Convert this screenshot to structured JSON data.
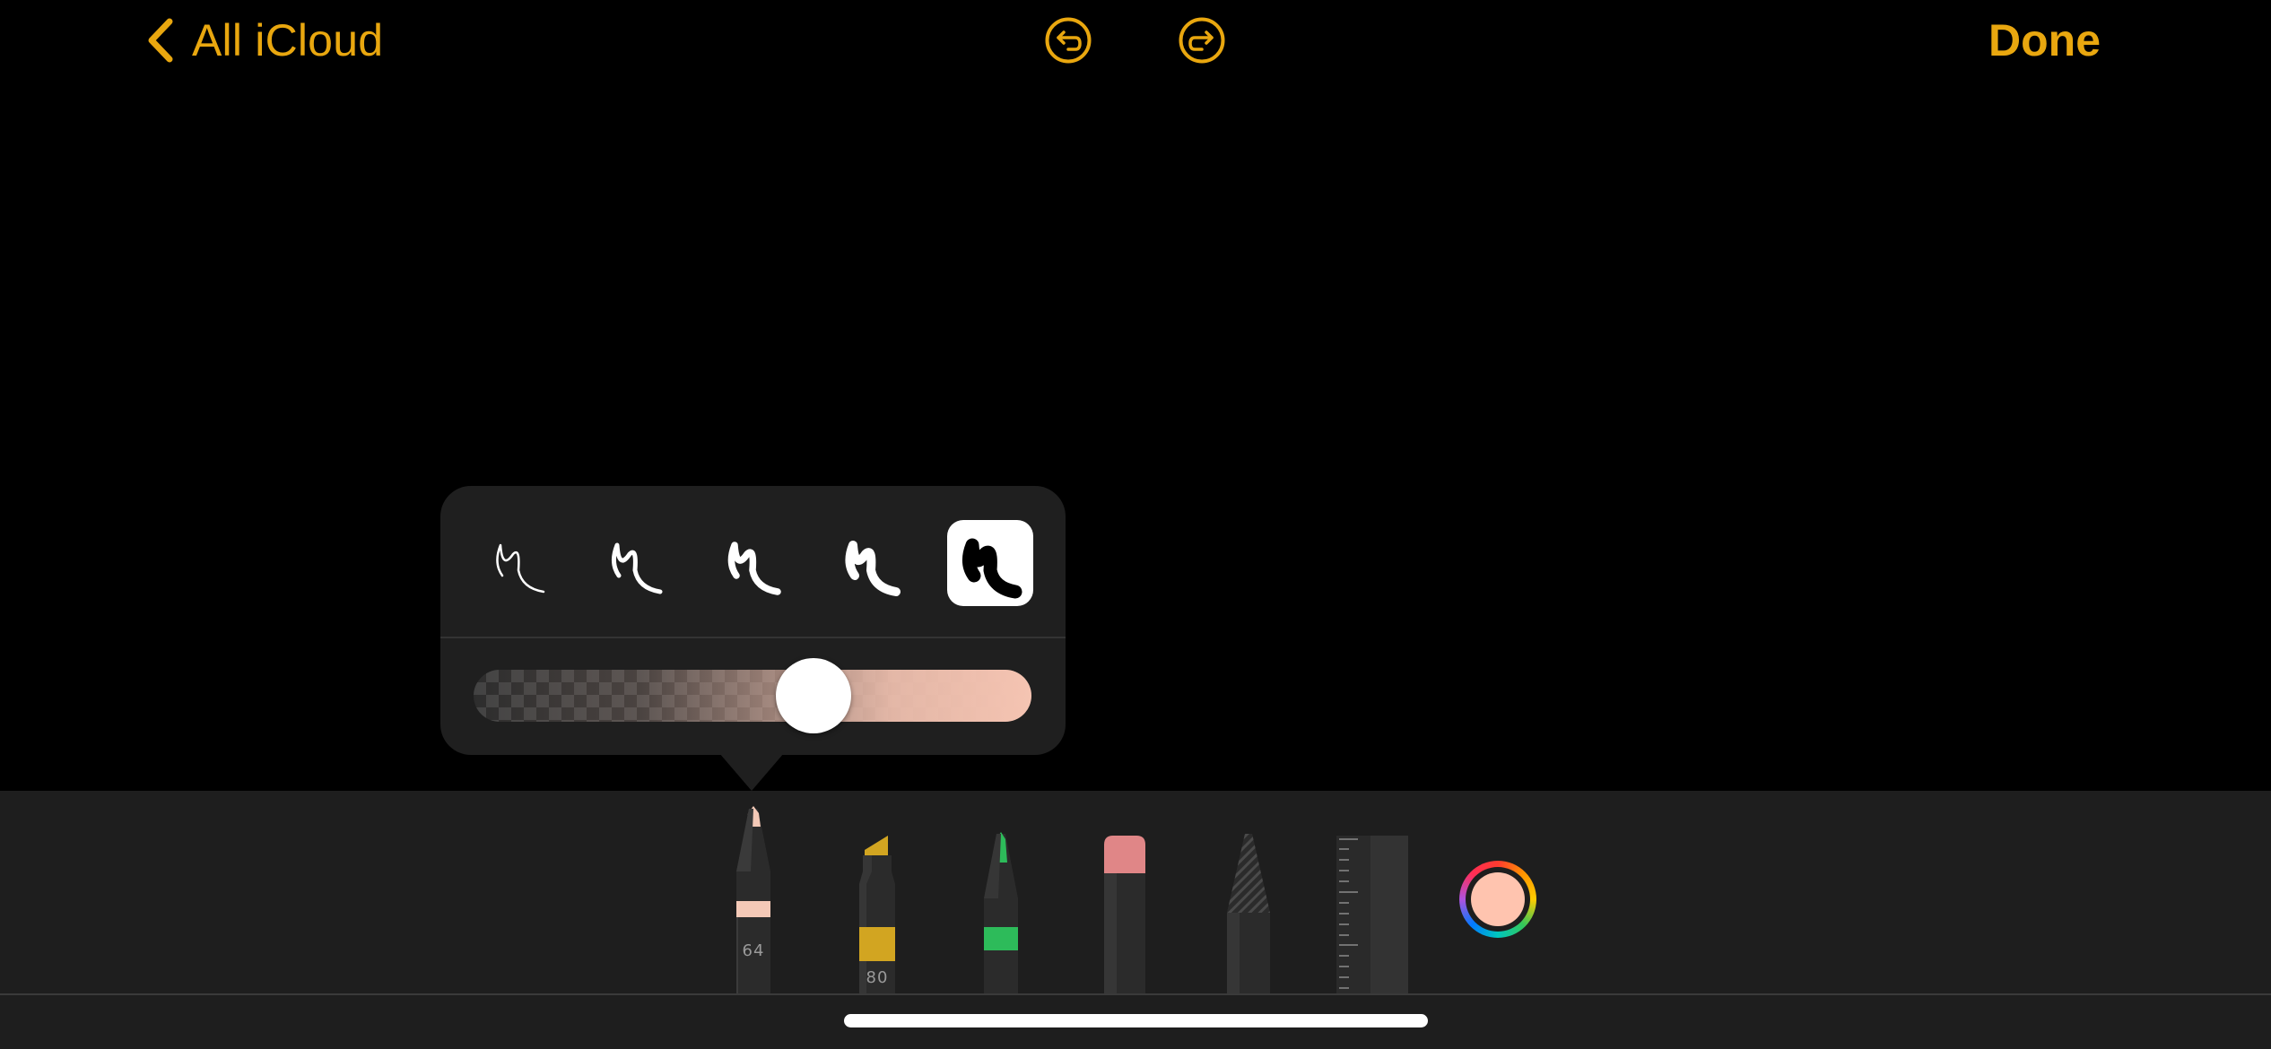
{
  "nav": {
    "back_label": "All iCloud",
    "done_label": "Done",
    "accent_color": "#E9A70F"
  },
  "icons": {
    "back": "chevron-left-icon",
    "undo": "undo-icon",
    "redo": "redo-icon"
  },
  "stroke_popover": {
    "stroke_widths": [
      "thinnest",
      "thin",
      "medium",
      "thick",
      "thickest"
    ],
    "selected_index": 4,
    "opacity_fraction": 0.62
  },
  "tools": [
    {
      "name": "pencil",
      "number": "64",
      "tip_color": "#F4C9B7",
      "selected": true
    },
    {
      "name": "marker",
      "number": "80",
      "tip_color": "#D2A521"
    },
    {
      "name": "pen",
      "number": "",
      "tip_color": "#2DBB5A"
    },
    {
      "name": "eraser",
      "number": "",
      "tip_color": "#E08687"
    },
    {
      "name": "lasso",
      "number": ""
    },
    {
      "name": "ruler",
      "number": ""
    }
  ],
  "current_color": "#FFC4AF"
}
